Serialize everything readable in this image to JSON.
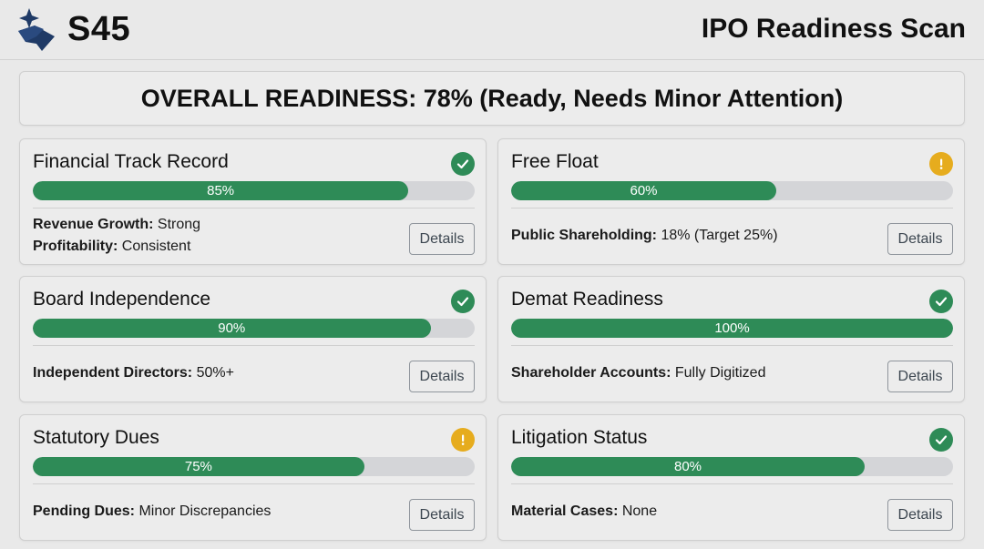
{
  "header": {
    "brand": "S45",
    "logo_icon": "diamond-star-logo",
    "title": "IPO Readiness Scan"
  },
  "overall": {
    "text": "OVERALL READINESS: 78% (Ready, Needs Minor Attention)"
  },
  "colors": {
    "accent_green": "#2e8b57",
    "warning_amber": "#e6ac1e",
    "logo_navy": "#1f3a66",
    "track_gray": "#d4d5d8"
  },
  "cards": [
    {
      "title": "Financial Track Record",
      "status": "ok",
      "status_icon": "check-circle-icon",
      "progress": 85,
      "progress_label": "85%",
      "metrics": [
        {
          "label": "Revenue Growth:",
          "value": " Strong"
        },
        {
          "label": "Profitability:",
          "value": " Consistent"
        }
      ],
      "details_label": "Details"
    },
    {
      "title": "Free Float",
      "status": "warn",
      "status_icon": "warning-circle-icon",
      "progress": 60,
      "progress_label": "60%",
      "metrics": [
        {
          "label": "Public Shareholding:",
          "value": " 18% (Target 25%)"
        }
      ],
      "details_label": "Details"
    },
    {
      "title": "Board Independence",
      "status": "ok",
      "status_icon": "check-circle-icon",
      "progress": 90,
      "progress_label": "90%",
      "metrics": [
        {
          "label": "Independent Directors:",
          "value": " 50%+"
        }
      ],
      "details_label": "Details"
    },
    {
      "title": "Demat Readiness",
      "status": "ok",
      "status_icon": "check-circle-icon",
      "progress": 100,
      "progress_label": "100%",
      "metrics": [
        {
          "label": "Shareholder Accounts:",
          "value": " Fully Digitized"
        }
      ],
      "details_label": "Details"
    },
    {
      "title": "Statutory Dues",
      "status": "warn",
      "status_icon": "warning-circle-icon",
      "progress": 75,
      "progress_label": "75%",
      "metrics": [
        {
          "label": "Pending Dues:",
          "value": " Minor Discrepancies"
        }
      ],
      "details_label": "Details"
    },
    {
      "title": "Litigation Status",
      "status": "ok",
      "status_icon": "check-circle-icon",
      "progress": 80,
      "progress_label": "80%",
      "metrics": [
        {
          "label": "Material Cases:",
          "value": " None"
        }
      ],
      "details_label": "Details"
    }
  ]
}
